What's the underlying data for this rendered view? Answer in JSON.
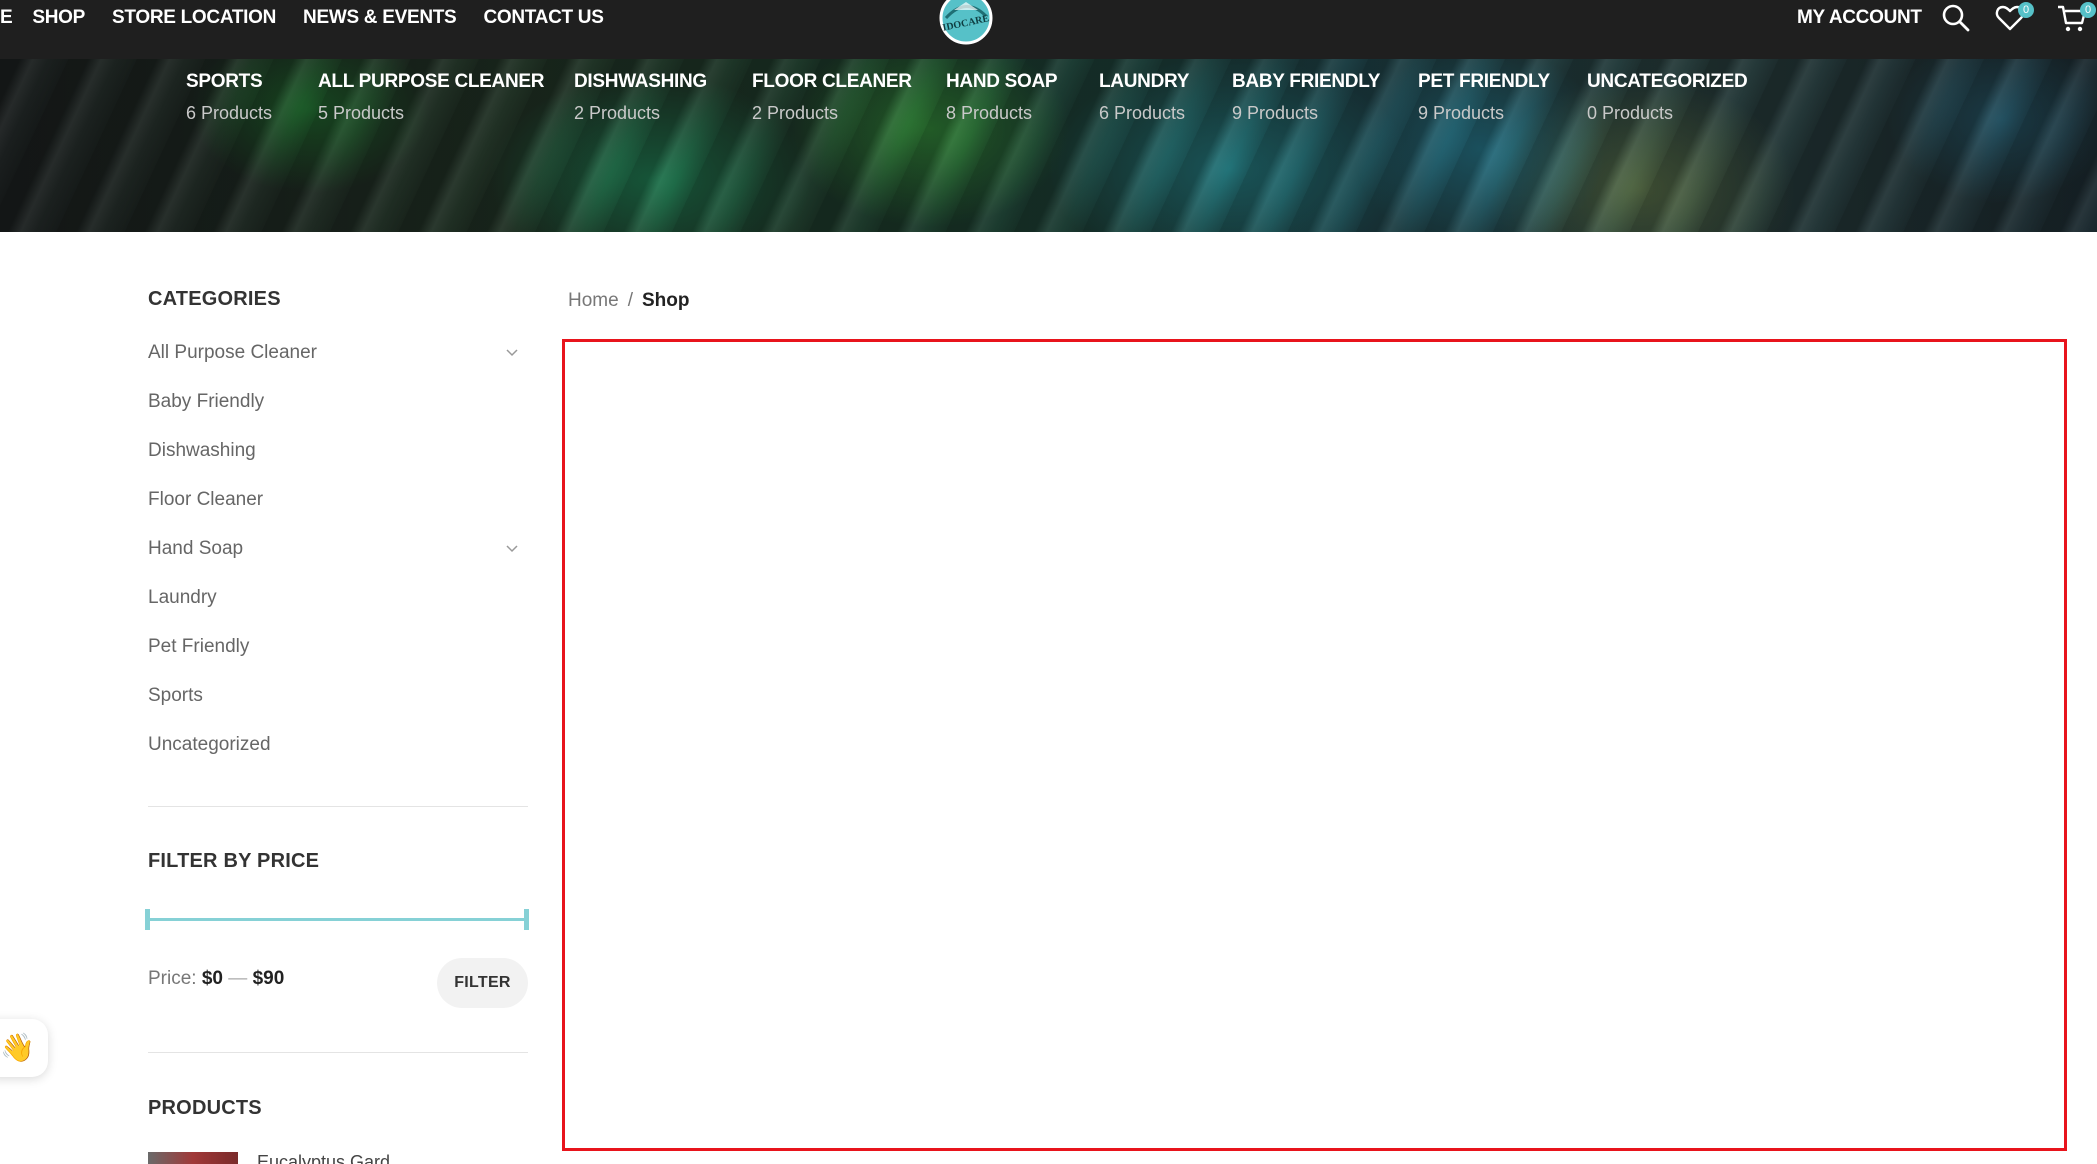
{
  "header": {
    "nav": [
      "E",
      "SHOP",
      "STORE LOCATION",
      "NEWS & EVENTS",
      "CONTACT US"
    ],
    "logo_text": "IDOCARE",
    "account_label": "MY ACCOUNT",
    "wishlist_count": "0",
    "cart_count": "0",
    "icons": [
      "search-icon",
      "heart-icon",
      "cart-icon"
    ]
  },
  "categories_banner": [
    {
      "title": "SPORTS",
      "count": "6 Products"
    },
    {
      "title": "ALL PURPOSE CLEANER",
      "count": "5 Products"
    },
    {
      "title": "DISHWASHING",
      "count": "2 Products"
    },
    {
      "title": "FLOOR CLEANER",
      "count": "2 Products"
    },
    {
      "title": "HAND SOAP",
      "count": "8 Products"
    },
    {
      "title": "LAUNDRY",
      "count": "6 Products"
    },
    {
      "title": "BABY FRIENDLY",
      "count": "9 Products"
    },
    {
      "title": "PET FRIENDLY",
      "count": "9 Products"
    },
    {
      "title": "UNCATEGORIZED",
      "count": "0 Products"
    }
  ],
  "sidebar": {
    "categories_title": "CATEGORIES",
    "categories": [
      {
        "label": "All Purpose Cleaner",
        "expandable": true
      },
      {
        "label": "Baby Friendly",
        "expandable": false
      },
      {
        "label": "Dishwashing",
        "expandable": false
      },
      {
        "label": "Floor Cleaner",
        "expandable": false
      },
      {
        "label": "Hand Soap",
        "expandable": true
      },
      {
        "label": "Laundry",
        "expandable": false
      },
      {
        "label": "Pet Friendly",
        "expandable": false
      },
      {
        "label": "Sports",
        "expandable": false
      },
      {
        "label": "Uncategorized",
        "expandable": false
      }
    ],
    "price_filter": {
      "title": "FILTER BY PRICE",
      "label": "Price:",
      "min": "$0",
      "dash": "—",
      "max": "$90",
      "button": "FILTER"
    },
    "products_title": "PRODUCTS",
    "first_product_name": "Eucalyptus Gard..."
  },
  "breadcrumb": {
    "home": "Home",
    "separator": "/",
    "current": "Shop"
  },
  "colors": {
    "accent": "#56c1c8",
    "highlight_border": "#e8141c",
    "topbar": "#1f1f1f"
  }
}
